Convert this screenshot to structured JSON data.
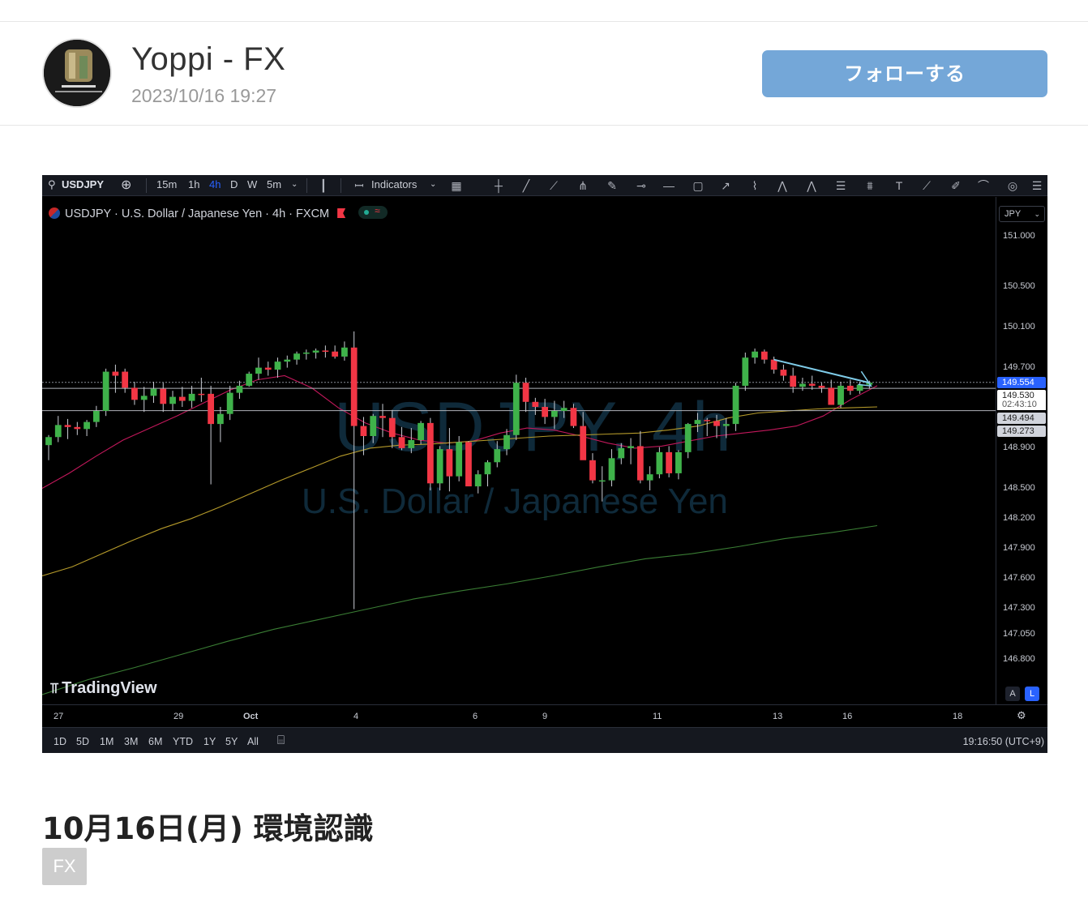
{
  "post": {
    "author": "Yoppi - FX",
    "date": "2023/10/16 19:27",
    "follow_label": "フォローする",
    "title": "10月16日(月) 環境認識",
    "tag": "FX"
  },
  "toolbar": {
    "symbol": "USDJPY",
    "intervals": [
      "15m",
      "1h",
      "4h",
      "D",
      "W",
      "5m"
    ],
    "active_interval": "4h",
    "indicators_label": "Indicators"
  },
  "legend": {
    "text": "USDJPY · U.S. Dollar / Japanese Yen · 4h · FXCM"
  },
  "watermark": {
    "symbol": "USDJPY, 4h",
    "name": "U.S. Dollar / Japanese Yen"
  },
  "brand": "TradingView",
  "currency": "JPY",
  "price_labels": {
    "last": "149.554",
    "current": "149.530",
    "countdown": "02:43:10",
    "level1": "149.494",
    "level2": "149.273"
  },
  "bottombar": {
    "ranges": [
      "1D",
      "5D",
      "1M",
      "3M",
      "6M",
      "YTD",
      "1Y",
      "5Y",
      "All"
    ],
    "clock": "19:16:50 (UTC+9)"
  },
  "colors": {
    "up": "#3fb24a",
    "down": "#f23645",
    "ma_fast": "#c2185b",
    "ma_mid": "#b59a2a",
    "ma_slow": "#3a7d34",
    "trendline": "#7ecbe8",
    "follow_button": "#74a7d8"
  },
  "chart_data": {
    "type": "candlestick",
    "y_ticks": [
      "151.000",
      "150.500",
      "150.100",
      "149.700",
      "148.900",
      "148.500",
      "148.200",
      "147.900",
      "147.600",
      "147.300",
      "147.050",
      "146.800"
    ],
    "x_ticks": [
      "27",
      "29",
      "Oct",
      "4",
      "6",
      "9",
      "11",
      "13",
      "16",
      "18"
    ],
    "ylim": [
      146.45,
      151.3
    ],
    "candles": [
      {
        "o": 148.93,
        "h": 149.03,
        "l": 148.78,
        "c": 149.01
      },
      {
        "o": 149.01,
        "h": 149.22,
        "l": 148.96,
        "c": 149.13
      },
      {
        "o": 149.13,
        "h": 149.19,
        "l": 148.99,
        "c": 149.11
      },
      {
        "o": 149.11,
        "h": 149.16,
        "l": 149.03,
        "c": 149.09
      },
      {
        "o": 149.09,
        "h": 149.18,
        "l": 149.02,
        "c": 149.16
      },
      {
        "o": 149.16,
        "h": 149.32,
        "l": 149.11,
        "c": 149.27
      },
      {
        "o": 149.27,
        "h": 149.69,
        "l": 149.22,
        "c": 149.66
      },
      {
        "o": 149.66,
        "h": 149.73,
        "l": 149.45,
        "c": 149.62
      },
      {
        "o": 149.66,
        "h": 149.69,
        "l": 149.45,
        "c": 149.5
      },
      {
        "o": 149.5,
        "h": 149.56,
        "l": 149.33,
        "c": 149.38
      },
      {
        "o": 149.38,
        "h": 149.51,
        "l": 149.26,
        "c": 149.42
      },
      {
        "o": 149.42,
        "h": 149.56,
        "l": 149.35,
        "c": 149.49
      },
      {
        "o": 149.49,
        "h": 149.55,
        "l": 149.26,
        "c": 149.34
      },
      {
        "o": 149.34,
        "h": 149.47,
        "l": 149.27,
        "c": 149.41
      },
      {
        "o": 149.41,
        "h": 149.51,
        "l": 149.31,
        "c": 149.37
      },
      {
        "o": 149.37,
        "h": 149.52,
        "l": 149.3,
        "c": 149.44
      },
      {
        "o": 149.44,
        "h": 149.6,
        "l": 149.36,
        "c": 149.43
      },
      {
        "o": 149.44,
        "h": 149.52,
        "l": 148.54,
        "c": 149.14
      },
      {
        "o": 149.14,
        "h": 149.31,
        "l": 148.96,
        "c": 149.24
      },
      {
        "o": 149.24,
        "h": 149.52,
        "l": 149.18,
        "c": 149.45
      },
      {
        "o": 149.45,
        "h": 149.57,
        "l": 149.39,
        "c": 149.52
      },
      {
        "o": 149.52,
        "h": 149.66,
        "l": 149.51,
        "c": 149.64
      },
      {
        "o": 149.64,
        "h": 149.8,
        "l": 149.58,
        "c": 149.7
      },
      {
        "o": 149.7,
        "h": 149.76,
        "l": 149.62,
        "c": 149.68
      },
      {
        "o": 149.68,
        "h": 149.8,
        "l": 149.6,
        "c": 149.76
      },
      {
        "o": 149.76,
        "h": 149.82,
        "l": 149.7,
        "c": 149.78
      },
      {
        "o": 149.78,
        "h": 149.86,
        "l": 149.73,
        "c": 149.84
      },
      {
        "o": 149.84,
        "h": 149.88,
        "l": 149.78,
        "c": 149.85
      },
      {
        "o": 149.85,
        "h": 149.89,
        "l": 149.79,
        "c": 149.87
      },
      {
        "o": 149.87,
        "h": 149.92,
        "l": 149.8,
        "c": 149.86
      },
      {
        "o": 149.86,
        "h": 149.92,
        "l": 149.79,
        "c": 149.81
      },
      {
        "o": 149.81,
        "h": 149.96,
        "l": 149.77,
        "c": 149.9
      },
      {
        "o": 149.9,
        "h": 150.06,
        "l": 147.3,
        "c": 149.12
      },
      {
        "o": 149.12,
        "h": 149.21,
        "l": 148.83,
        "c": 149.02
      },
      {
        "o": 149.02,
        "h": 149.24,
        "l": 148.95,
        "c": 149.22
      },
      {
        "o": 149.22,
        "h": 149.34,
        "l": 149.01,
        "c": 149.2
      },
      {
        "o": 149.2,
        "h": 149.28,
        "l": 148.9,
        "c": 149.01
      },
      {
        "o": 149.01,
        "h": 149.11,
        "l": 148.88,
        "c": 148.9
      },
      {
        "o": 148.9,
        "h": 149.1,
        "l": 148.85,
        "c": 148.98
      },
      {
        "o": 148.98,
        "h": 149.17,
        "l": 148.94,
        "c": 149.15
      },
      {
        "o": 149.15,
        "h": 149.2,
        "l": 148.48,
        "c": 148.55
      },
      {
        "o": 148.55,
        "h": 148.92,
        "l": 148.48,
        "c": 148.89
      },
      {
        "o": 148.89,
        "h": 149.1,
        "l": 148.47,
        "c": 148.62
      },
      {
        "o": 148.62,
        "h": 149.02,
        "l": 148.57,
        "c": 148.96
      },
      {
        "o": 148.96,
        "h": 148.97,
        "l": 148.57,
        "c": 148.52
      },
      {
        "o": 148.52,
        "h": 148.68,
        "l": 148.45,
        "c": 148.64
      },
      {
        "o": 148.64,
        "h": 148.78,
        "l": 148.52,
        "c": 148.76
      },
      {
        "o": 148.76,
        "h": 148.97,
        "l": 148.71,
        "c": 148.89
      },
      {
        "o": 148.89,
        "h": 149.09,
        "l": 148.83,
        "c": 149.03
      },
      {
        "o": 149.03,
        "h": 149.63,
        "l": 148.98,
        "c": 149.55
      },
      {
        "o": 149.55,
        "h": 149.6,
        "l": 149.26,
        "c": 149.36
      },
      {
        "o": 149.36,
        "h": 149.4,
        "l": 149.23,
        "c": 149.31
      },
      {
        "o": 149.31,
        "h": 149.39,
        "l": 149.14,
        "c": 149.21
      },
      {
        "o": 149.21,
        "h": 149.37,
        "l": 149.09,
        "c": 149.27
      },
      {
        "o": 149.27,
        "h": 149.37,
        "l": 149.2,
        "c": 149.3
      },
      {
        "o": 149.3,
        "h": 149.34,
        "l": 149.1,
        "c": 149.12
      },
      {
        "o": 149.12,
        "h": 149.26,
        "l": 148.82,
        "c": 148.78
      },
      {
        "o": 148.78,
        "h": 148.85,
        "l": 148.55,
        "c": 148.58
      },
      {
        "o": 148.58,
        "h": 148.72,
        "l": 148.37,
        "c": 148.58
      },
      {
        "o": 148.58,
        "h": 148.89,
        "l": 148.52,
        "c": 148.8
      },
      {
        "o": 148.8,
        "h": 148.95,
        "l": 148.74,
        "c": 148.9
      },
      {
        "o": 148.9,
        "h": 149.0,
        "l": 148.74,
        "c": 148.92
      },
      {
        "o": 148.92,
        "h": 149.07,
        "l": 148.55,
        "c": 148.58
      },
      {
        "o": 148.58,
        "h": 148.72,
        "l": 148.48,
        "c": 148.64
      },
      {
        "o": 148.64,
        "h": 148.91,
        "l": 148.6,
        "c": 148.86
      },
      {
        "o": 148.86,
        "h": 148.92,
        "l": 148.61,
        "c": 148.65
      },
      {
        "o": 148.65,
        "h": 148.88,
        "l": 148.59,
        "c": 148.86
      },
      {
        "o": 148.86,
        "h": 149.15,
        "l": 148.8,
        "c": 149.14
      },
      {
        "o": 149.14,
        "h": 149.25,
        "l": 149.06,
        "c": 149.18
      },
      {
        "o": 149.18,
        "h": 149.2,
        "l": 149.02,
        "c": 149.17
      },
      {
        "o": 149.17,
        "h": 149.23,
        "l": 149.0,
        "c": 149.12
      },
      {
        "o": 149.12,
        "h": 149.2,
        "l": 149.0,
        "c": 149.14
      },
      {
        "o": 149.14,
        "h": 149.55,
        "l": 149.07,
        "c": 149.52
      },
      {
        "o": 149.52,
        "h": 149.85,
        "l": 149.47,
        "c": 149.8
      },
      {
        "o": 149.8,
        "h": 149.89,
        "l": 149.74,
        "c": 149.86
      },
      {
        "o": 149.86,
        "h": 149.88,
        "l": 149.74,
        "c": 149.78
      },
      {
        "o": 149.78,
        "h": 149.81,
        "l": 149.64,
        "c": 149.68
      },
      {
        "o": 149.68,
        "h": 149.73,
        "l": 149.57,
        "c": 149.62
      },
      {
        "o": 149.62,
        "h": 149.7,
        "l": 149.45,
        "c": 149.51
      },
      {
        "o": 149.51,
        "h": 149.6,
        "l": 149.47,
        "c": 149.54
      },
      {
        "o": 149.54,
        "h": 149.62,
        "l": 149.48,
        "c": 149.52
      },
      {
        "o": 149.52,
        "h": 149.55,
        "l": 149.45,
        "c": 149.5
      },
      {
        "o": 149.5,
        "h": 149.58,
        "l": 149.33,
        "c": 149.33
      },
      {
        "o": 149.33,
        "h": 149.56,
        "l": 149.3,
        "c": 149.52
      },
      {
        "o": 149.52,
        "h": 149.58,
        "l": 149.43,
        "c": 149.47
      },
      {
        "o": 149.47,
        "h": 149.56,
        "l": 149.44,
        "c": 149.53
      },
      {
        "o": 149.53,
        "h": 149.57,
        "l": 149.49,
        "c": 149.55
      }
    ],
    "moving_averages": [
      {
        "name": "ma_fast",
        "points": [
          148.5,
          148.65,
          148.82,
          148.98,
          149.1,
          149.22,
          149.35,
          149.48,
          149.58,
          149.62,
          149.5,
          149.3,
          149.15,
          149.05,
          148.98,
          148.95,
          148.97,
          149.05,
          149.1,
          149.08,
          149.02,
          148.95,
          148.9,
          148.92,
          148.97,
          149.02,
          149.05,
          149.08,
          149.12,
          149.22,
          149.38,
          149.52
        ]
      },
      {
        "name": "ma_mid",
        "points": [
          147.63,
          147.72,
          147.85,
          147.98,
          148.1,
          148.2,
          148.32,
          148.45,
          148.58,
          148.7,
          148.82,
          148.9,
          148.93,
          148.94,
          148.96,
          148.98,
          149.0,
          149.02,
          149.03,
          149.04,
          149.05,
          149.08,
          149.12,
          149.2,
          149.25,
          149.27,
          149.29,
          149.3,
          149.31
        ]
      },
      {
        "name": "ma_slow",
        "points": [
          146.45,
          146.6,
          146.72,
          146.85,
          146.98,
          147.1,
          147.2,
          147.3,
          147.4,
          147.48,
          147.55,
          147.63,
          147.72,
          147.8,
          147.85,
          147.92,
          148.0,
          148.06,
          148.13
        ]
      }
    ],
    "trendline": [
      [
        149.78,
        149.55
      ]
    ],
    "horizontal_lines": [
      149.554,
      149.494,
      149.273
    ]
  }
}
